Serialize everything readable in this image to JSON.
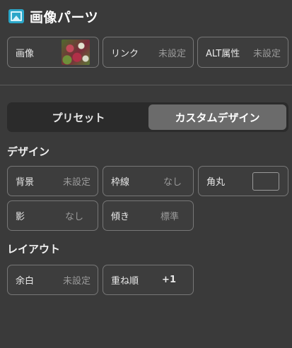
{
  "header": {
    "title": "画像パーツ",
    "icon": "image-icon"
  },
  "top_fields": {
    "image": {
      "label": "画像"
    },
    "link": {
      "label": "リンク",
      "value": "未設定"
    },
    "alt": {
      "label": "ALT属性",
      "value": "未設定"
    }
  },
  "tabs": {
    "preset": "プリセット",
    "custom": "カスタムデザイン",
    "active": "custom"
  },
  "design": {
    "title": "デザイン",
    "background": {
      "label": "背景",
      "value": "未設定"
    },
    "border": {
      "label": "枠線",
      "value": "なし"
    },
    "corner": {
      "label": "角丸"
    },
    "shadow": {
      "label": "影",
      "value": "なし"
    },
    "tilt": {
      "label": "傾き",
      "value": "標準"
    }
  },
  "layout": {
    "title": "レイアウト",
    "margin": {
      "label": "余白",
      "value": "未設定"
    },
    "stacking": {
      "label": "重ね順",
      "value": "+1"
    }
  },
  "colors": {
    "background": "#3a3a3a",
    "accent": "#2aa6c8",
    "active_tab": "#6b6b6b"
  }
}
